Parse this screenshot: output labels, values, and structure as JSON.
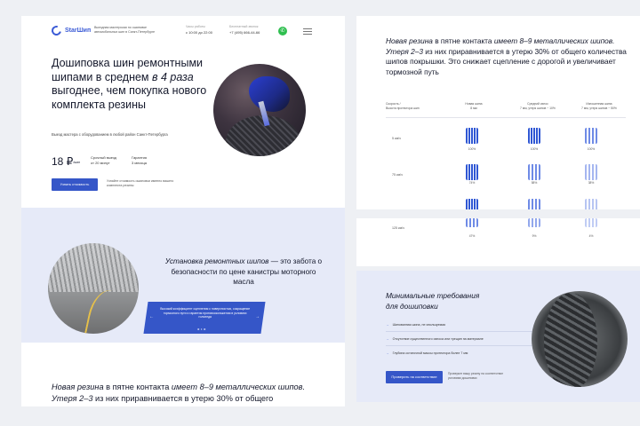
{
  "header": {
    "logo_text": "StarШип",
    "description": "Выездная мастерская по ошиповке автомобильных шин в Санкт-Петербурге",
    "hours_label": "Часы работы",
    "hours": "с 10:00 до 22:00",
    "phone_label": "Бесплатный звонок",
    "phone": "+7 (495) 666-44-66"
  },
  "hero": {
    "title_line1": "Дошиповка шин ремонтными шипами в среднем ",
    "title_em": "в 4 раза",
    "title_line2": " выгоднее, чем покупка нового комплекта резины",
    "subtitle": "Выезд мастера с оборудованием в любой район Санкт-Петербурга",
    "price": "18 ₽",
    "price_unit": "/шип",
    "feature1_line1": "Срочный выезд",
    "feature1_line2": "от 20 минут",
    "feature2_line1": "Гарантия",
    "feature2_line2": "3 месяца",
    "cta": "Узнать стоимость",
    "cta_note": "Узнайте стоимость ошиповки именно вашего комплекта резины"
  },
  "blue_section": {
    "title_em": "Установка ремонтных шипов",
    "title_rest": " — это забота о безопасности по цене канистры моторного масла",
    "slide_text": "Высокий коэффициент сцепления с поверхностью, сокращение тормозного пути и гарантия противоскольжения в условиях гололеда"
  },
  "bottom_text": {
    "em1": "Новая резина",
    "t1": " в пятне контакта ",
    "em2": "имеет 8–9 металлических шипов. Утеря 2–3",
    "t2": " из них приравнивается в утерю 30% от общего"
  },
  "right_top": {
    "em1": "Новая резина",
    "t1": " в пятне контакта ",
    "em2": "имеет 8–9 металлических шипов. Утеря 2–3",
    "t2": " из них приравнивается в утерю 30% от общего количества шипов покрышки. Это снижает сцепление с дорогой и увеличивает тормозной путь",
    "col0_line1": "Скорость /",
    "col0_line2": "Высота протектора шин",
    "col1_line1": "Новая шина",
    "col1_line2": "8 мм",
    "col2_line1": "Средний износ",
    "col2_line2": "7 мм, утеря шипов ~ 10%",
    "col3_line1": "Изношенная шина",
    "col3_line2": "7 мм, утеря шипов ~ 50%",
    "rows": [
      {
        "label": "5 км/ч",
        "v1": "100%",
        "v2": "100%",
        "v3": "100%"
      },
      {
        "label": "75 км/ч",
        "v1": "74%",
        "v2": "58%",
        "v3": "38%"
      }
    ]
  },
  "right_mid": {
    "label": "125 км/ч",
    "v1": "47%",
    "v2": "9%",
    "v3": "4%"
  },
  "right_bot": {
    "title_line1": "Минимальные требования",
    "title_line2": "для дошиповки",
    "items": [
      "Шипованная шина, не ипользуемая",
      "Отсутствие существенного износа или трещин на материале",
      "Глубина остаточной массы протектора более 7 мм"
    ],
    "cta": "Проверить на соответствие",
    "cta_note": "Проверьте вашу резину на соответствие условиям дошиповки"
  }
}
